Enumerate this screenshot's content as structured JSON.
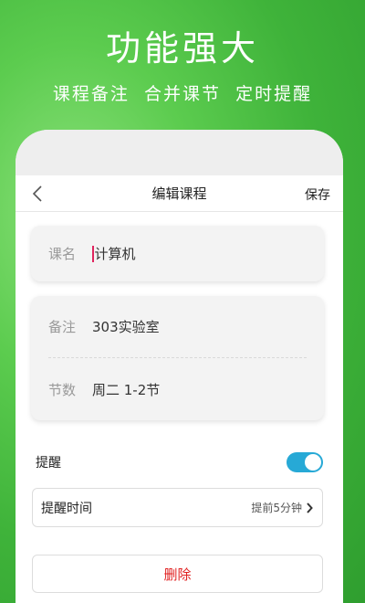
{
  "promo": {
    "title": "功能强大",
    "subtitle": "课程备注  合并课节  定时提醒"
  },
  "navbar": {
    "title": "编辑课程",
    "save_label": "保存"
  },
  "course": {
    "name_label": "课名",
    "name_value": "计算机",
    "note_label": "备注",
    "note_value": "303实验室",
    "section_label": "节数",
    "section_value": "周二 1-2节"
  },
  "reminder": {
    "label": "提醒",
    "enabled": true,
    "time_label": "提醒时间",
    "time_value": "提前5分钟"
  },
  "actions": {
    "delete_label": "删除"
  },
  "colors": {
    "toggle_on": "#27a9d6",
    "delete_text": "#e02020",
    "caret": "#e0245e"
  },
  "icons": {
    "back": "chevron-left-icon",
    "arrow": "chevron-right-icon"
  }
}
